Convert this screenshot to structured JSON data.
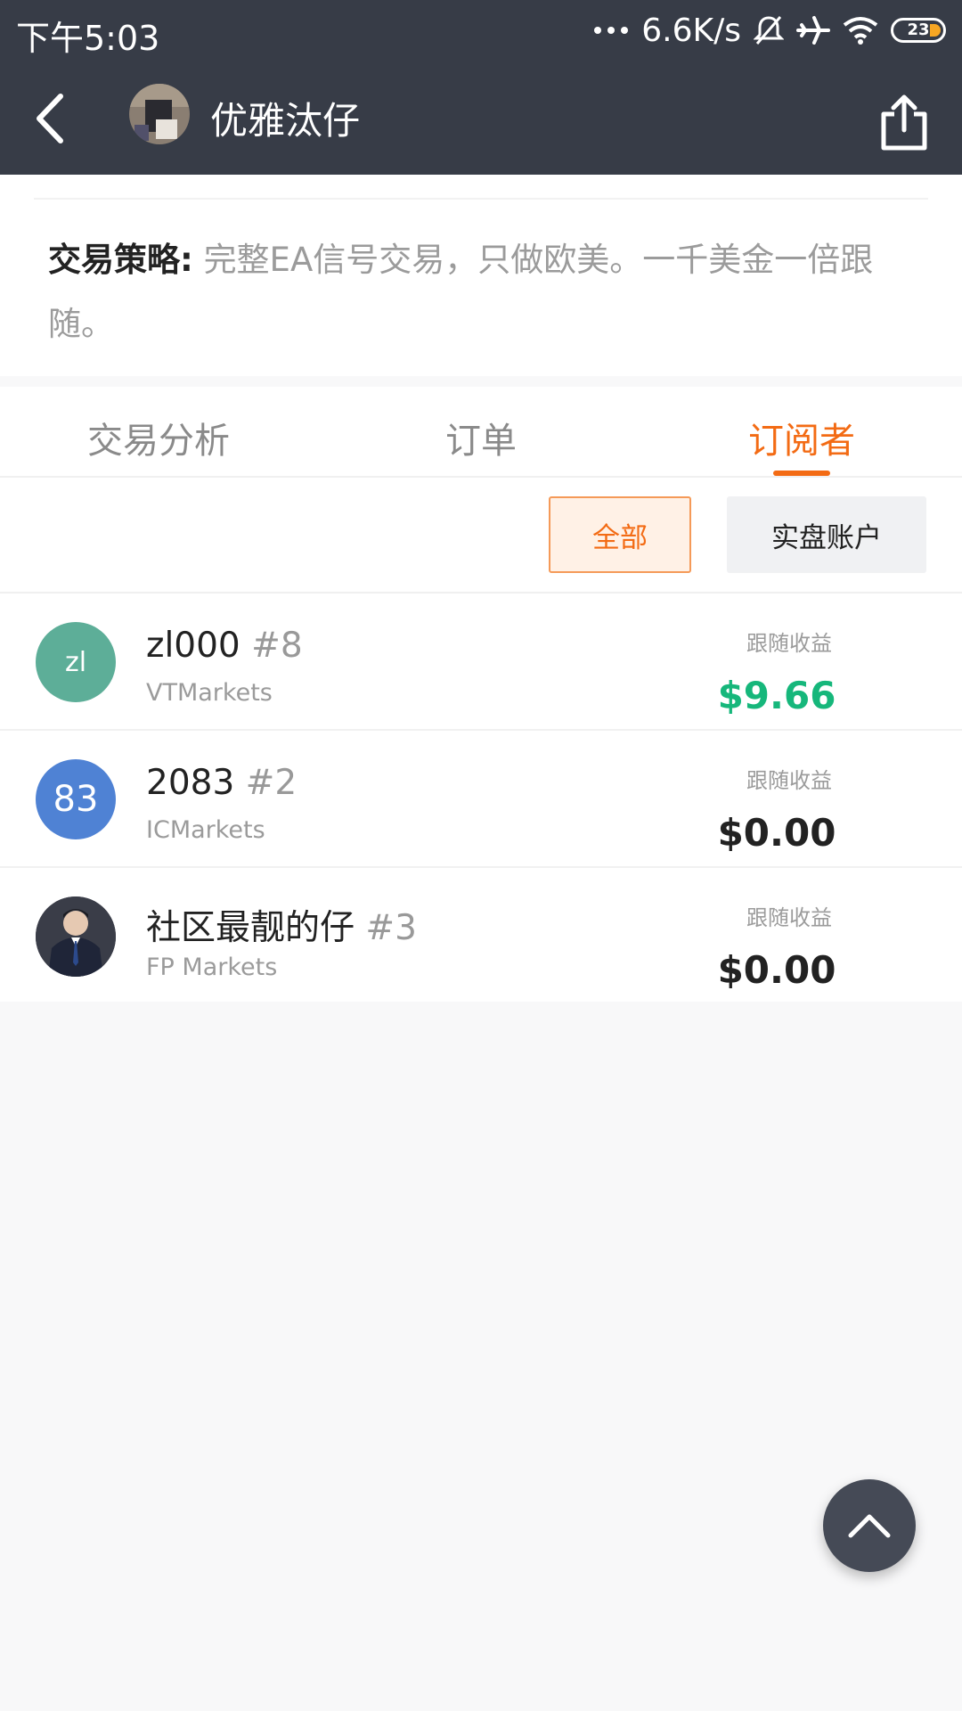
{
  "status_bar": {
    "time": "下午5:03",
    "network_speed": "6.6K/s",
    "battery": "23"
  },
  "header": {
    "title": "优雅汰仔"
  },
  "strategy": {
    "label": "交易策略:",
    "text": "完整EA信号交易，只做欧美。一千美金一倍跟随。"
  },
  "tabs": [
    {
      "label": "交易分析"
    },
    {
      "label": "订单"
    },
    {
      "label": "订阅者",
      "active": true
    }
  ],
  "filters": {
    "all": "全部",
    "real_account": "实盘账户"
  },
  "subscribers": [
    {
      "name": "zl000",
      "rank": "#8",
      "broker": "VTMarkets",
      "avatar_text": "zl",
      "avatar_color": "#5dae98",
      "profit_label": "跟随收益",
      "profit": "$9.66"
    },
    {
      "name": "2083",
      "rank": "#2",
      "broker": "ICMarkets",
      "avatar_text": "83",
      "avatar_color": "#4f82d4",
      "profit_label": "跟随收益",
      "profit": "$0.00"
    },
    {
      "name": "社区最靓的仔",
      "rank": "#3",
      "broker": "FP Markets",
      "avatar_text": "",
      "avatar_color": "#2c2f3c",
      "profit_label": "跟随收益",
      "profit": "$0.00"
    }
  ],
  "colors": {
    "accent": "#f36b14",
    "header_bg": "#373c47",
    "profit_positive": "#16b77b"
  },
  "icons": {
    "back": "chevron-left-icon",
    "share": "share-icon",
    "scroll_top": "chevron-up-icon"
  }
}
